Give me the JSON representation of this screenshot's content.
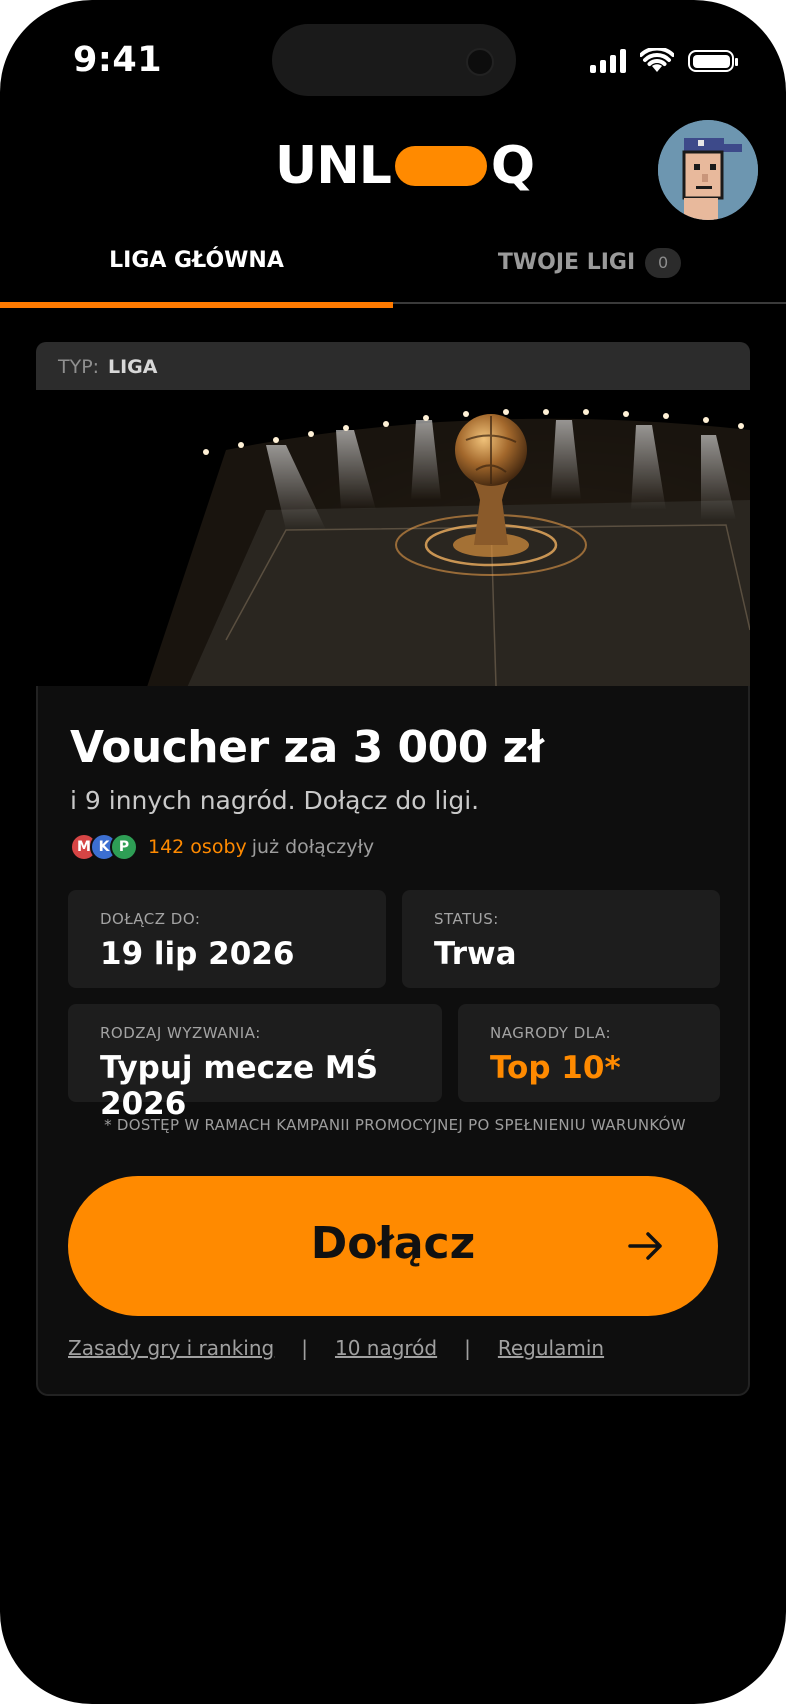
{
  "status_bar": {
    "time": "9:41"
  },
  "header": {
    "logo_left": "UNL",
    "logo_right": "Q"
  },
  "tabs": [
    {
      "label": "LIGA GŁÓWNA",
      "active": true
    },
    {
      "label": "TWOJE LIGI",
      "badge": "0",
      "active": false
    }
  ],
  "card": {
    "type_label": "TYP:",
    "type_value": "LIGA",
    "title": "Voucher za 3 000 zł",
    "subtitle": "i 9 innych nagród. Dołącz do ligi.",
    "avatars": [
      {
        "initial": "M",
        "color": "#d64545"
      },
      {
        "initial": "K",
        "color": "#3c6fd1"
      },
      {
        "initial": "P",
        "color": "#2e9e55"
      }
    ],
    "joined_count": "142 osoby",
    "joined_text": "już dołączyły",
    "join_until": {
      "label": "DOŁĄCZ DO:",
      "value": "19 lip 2026"
    },
    "status": {
      "label": "STATUS:",
      "value": "Trwa"
    },
    "challenge": {
      "label": "RODZAJ WYZWANIA:",
      "value": "Typuj mecze MŚ 2026"
    },
    "prizes": {
      "label": "NAGRODY DLA:",
      "value": "Top 10*"
    },
    "disclaimer": "* DOSTĘP W RAMACH KAMPANII PROMOCYJNEJ PO SPEŁNIENIU WARUNKÓW",
    "join_button": "Dołącz",
    "links": [
      "Zasady gry i ranking",
      "10 nagród",
      "Regulamin"
    ],
    "link_separator": "|"
  },
  "colors": {
    "accent": "#ff8a00",
    "background": "#000000",
    "card": "#0e0e0e"
  }
}
